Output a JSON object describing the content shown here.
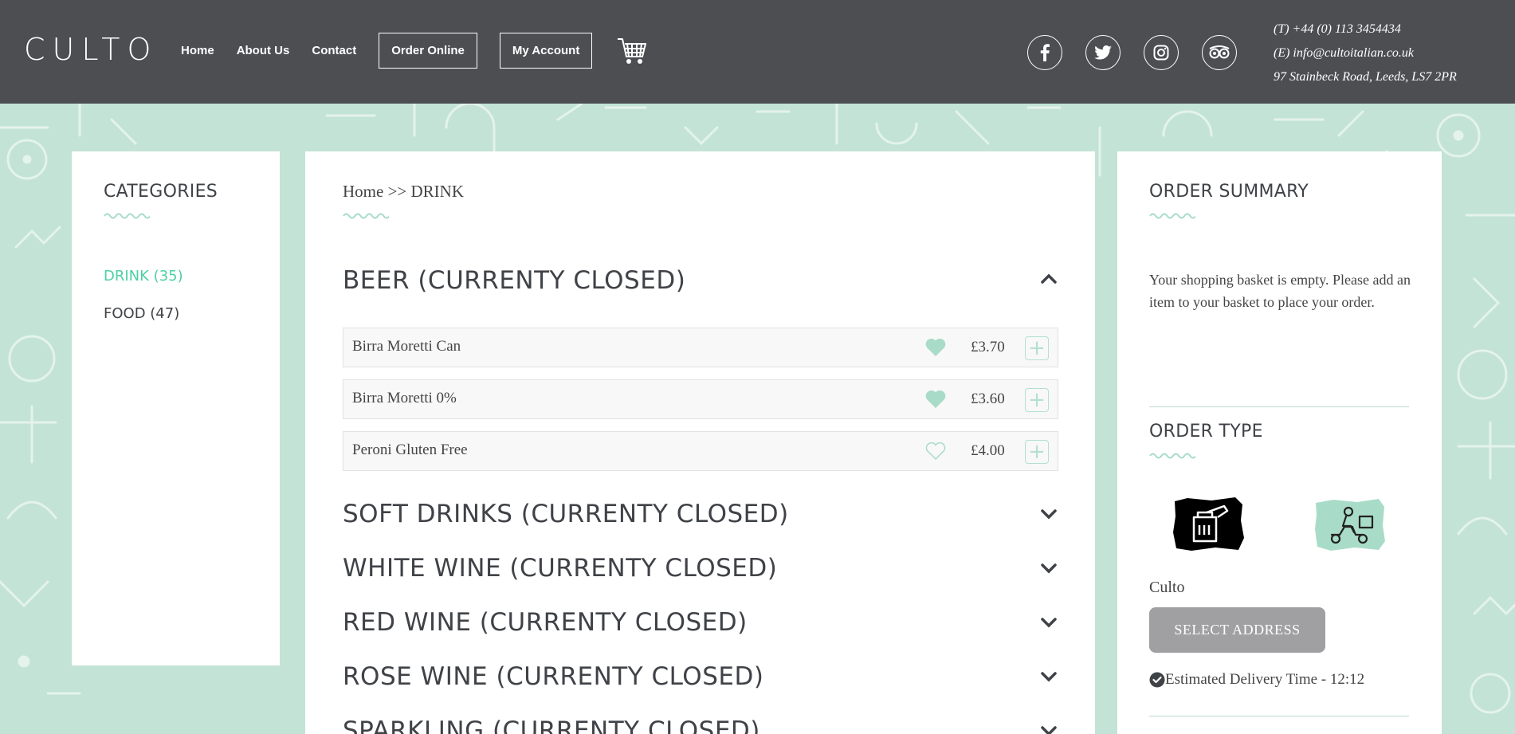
{
  "header": {
    "logo": "CULTO",
    "nav": [
      "Home",
      "About Us",
      "Contact"
    ],
    "order_online": "Order Online",
    "my_account": "My Account",
    "contact_phone": "(T) +44 (0) 113 3454434",
    "contact_email": "(E) info@cultoitalian.co.uk",
    "contact_address": "97 Stainbeck Road, Leeds, LS7 2PR",
    "social_icons": [
      "facebook-icon",
      "twitter-icon",
      "instagram-icon",
      "tripadvisor-icon"
    ]
  },
  "categories": {
    "title": "CATEGORIES",
    "items": [
      {
        "label": "DRINK (35)",
        "active": true
      },
      {
        "label": "FOOD (47)",
        "active": false
      }
    ]
  },
  "main": {
    "breadcrumb": "Home >> DRINK",
    "sections": [
      {
        "title": "BEER (CURRENTY CLOSED)",
        "expanded": true,
        "items": [
          {
            "name": "Birra Moretti Can",
            "price": "£3.70",
            "favorite": true
          },
          {
            "name": "Birra Moretti 0%",
            "price": "£3.60",
            "favorite": true
          },
          {
            "name": "Peroni Gluten Free",
            "price": "£4.00",
            "favorite": false
          }
        ]
      },
      {
        "title": "SOFT DRINKS (CURRENTY CLOSED)",
        "expanded": false
      },
      {
        "title": "WHITE WINE (CURRENTY CLOSED)",
        "expanded": false
      },
      {
        "title": "RED WINE (CURRENTY CLOSED)",
        "expanded": false
      },
      {
        "title": "ROSE WINE (CURRENTY CLOSED)",
        "expanded": false
      },
      {
        "title": "SPARKLING (CURRENTY CLOSED)",
        "expanded": false
      }
    ]
  },
  "order_summary": {
    "title": "ORDER SUMMARY",
    "empty_message": "Your shopping basket is empty. Please add an item to your basket to place your order."
  },
  "order_type": {
    "title": "ORDER TYPE",
    "options": [
      "collection-icon",
      "delivery-icon"
    ],
    "location": "Culto",
    "select_address": "SELECT ADDRESS",
    "estimated": "Estimated Delivery Time - 12:12"
  },
  "colors": {
    "header_bg": "#4d4e52",
    "page_bg": "#c3e3d7",
    "accent": "#4ed0a3",
    "mint": "#a9dcc8",
    "button_grey": "#a09fa1"
  }
}
